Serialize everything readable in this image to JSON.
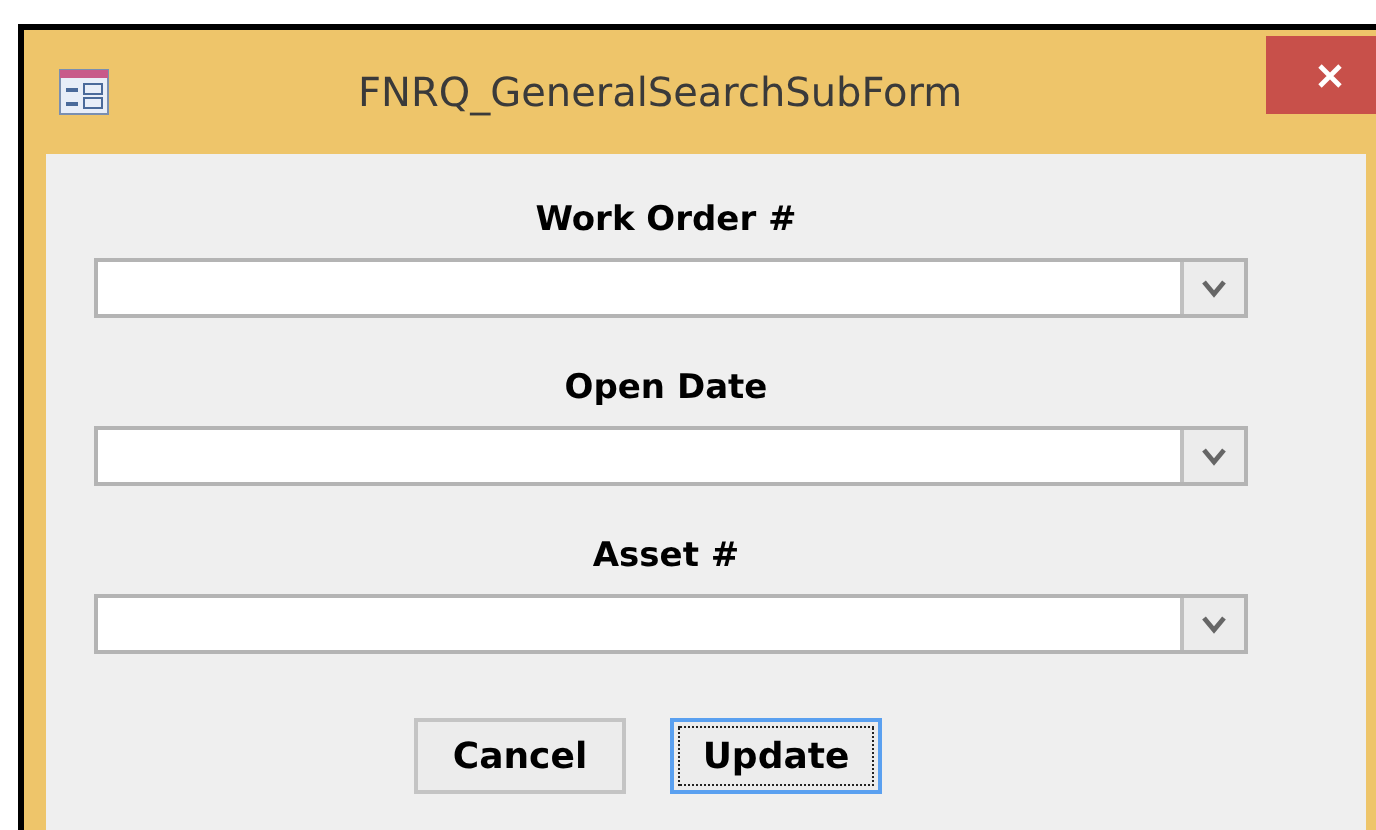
{
  "window": {
    "title": "FNRQ_GeneralSearchSubForm"
  },
  "fields": [
    {
      "label": "Work Order #"
    },
    {
      "label": "Open Date"
    },
    {
      "label": "Asset #"
    }
  ],
  "buttons": [
    {
      "label": "Cancel",
      "focused": false
    },
    {
      "label": "Update",
      "focused": true
    }
  ]
}
